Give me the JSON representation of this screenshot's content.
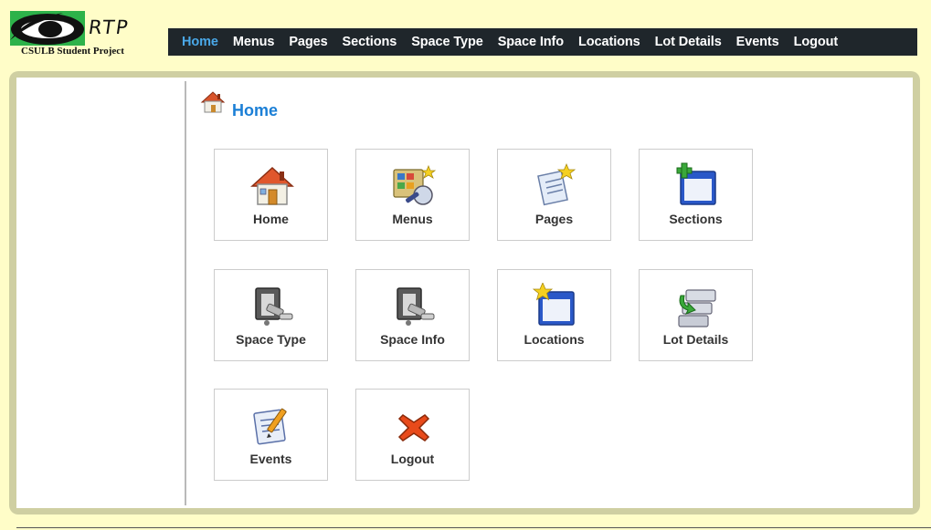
{
  "logo": {
    "wordmark": "RTP",
    "subtitle": "CSULB Student Project"
  },
  "nav": {
    "items": [
      {
        "label": "Home",
        "active": true
      },
      {
        "label": "Menus"
      },
      {
        "label": "Pages"
      },
      {
        "label": "Sections"
      },
      {
        "label": "Space Type"
      },
      {
        "label": "Space Info"
      },
      {
        "label": "Locations"
      },
      {
        "label": "Lot Details"
      },
      {
        "label": "Events"
      },
      {
        "label": "Logout"
      }
    ]
  },
  "page": {
    "title": "Home",
    "title_icon": "home-icon"
  },
  "tiles": [
    {
      "label": "Home",
      "icon": "home-icon"
    },
    {
      "label": "Menus",
      "icon": "menus-icon"
    },
    {
      "label": "Pages",
      "icon": "pages-icon"
    },
    {
      "label": "Sections",
      "icon": "sections-icon"
    },
    {
      "label": "Space Type",
      "icon": "space-type-icon"
    },
    {
      "label": "Space Info",
      "icon": "space-info-icon"
    },
    {
      "label": "Locations",
      "icon": "locations-icon"
    },
    {
      "label": "Lot Details",
      "icon": "lot-details-icon"
    },
    {
      "label": "Events",
      "icon": "events-icon"
    },
    {
      "label": "Logout",
      "icon": "logout-icon"
    }
  ],
  "colors": {
    "background": "#fffdc8",
    "navbar": "#1f262b",
    "nav_active": "#4aa8e8",
    "heading": "#1b7fd6",
    "logo_green": "#2db24a"
  }
}
